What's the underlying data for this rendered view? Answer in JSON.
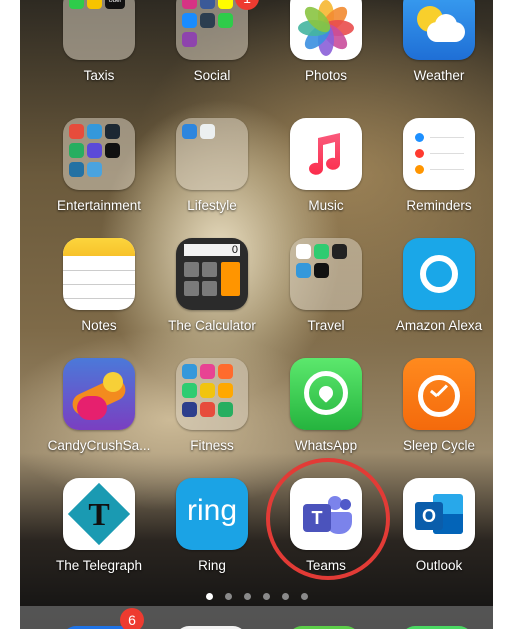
{
  "apps": [
    {
      "id": "taxis",
      "label": "Taxis"
    },
    {
      "id": "social",
      "label": "Social",
      "badge": "1"
    },
    {
      "id": "photos",
      "label": "Photos"
    },
    {
      "id": "weather",
      "label": "Weather"
    },
    {
      "id": "entertainment",
      "label": "Entertainment"
    },
    {
      "id": "lifestyle",
      "label": "Lifestyle"
    },
    {
      "id": "music",
      "label": "Music"
    },
    {
      "id": "reminders",
      "label": "Reminders"
    },
    {
      "id": "notes",
      "label": "Notes"
    },
    {
      "id": "calculator",
      "label": "The Calculator",
      "display": "0"
    },
    {
      "id": "travel",
      "label": "Travel"
    },
    {
      "id": "alexa",
      "label": "Amazon Alexa"
    },
    {
      "id": "candycrush",
      "label": "CandyCrushSa..."
    },
    {
      "id": "fitness",
      "label": "Fitness"
    },
    {
      "id": "whatsapp",
      "label": "WhatsApp"
    },
    {
      "id": "sleepcycle",
      "label": "Sleep Cycle"
    },
    {
      "id": "telegraph",
      "label": "The Telegraph",
      "glyph": "T"
    },
    {
      "id": "ring",
      "label": "Ring",
      "glyph": "ring"
    },
    {
      "id": "teams",
      "label": "Teams",
      "glyph": "T"
    },
    {
      "id": "outlook",
      "label": "Outlook",
      "glyph": "O"
    }
  ],
  "taxis_folder": {
    "uber_text": "Uber"
  },
  "dock": {
    "badge": "6"
  },
  "page_dots": {
    "count": 6,
    "active": 0
  },
  "colors": {
    "highlight_ring": "#e23b36",
    "badge": "#ee3b30"
  }
}
